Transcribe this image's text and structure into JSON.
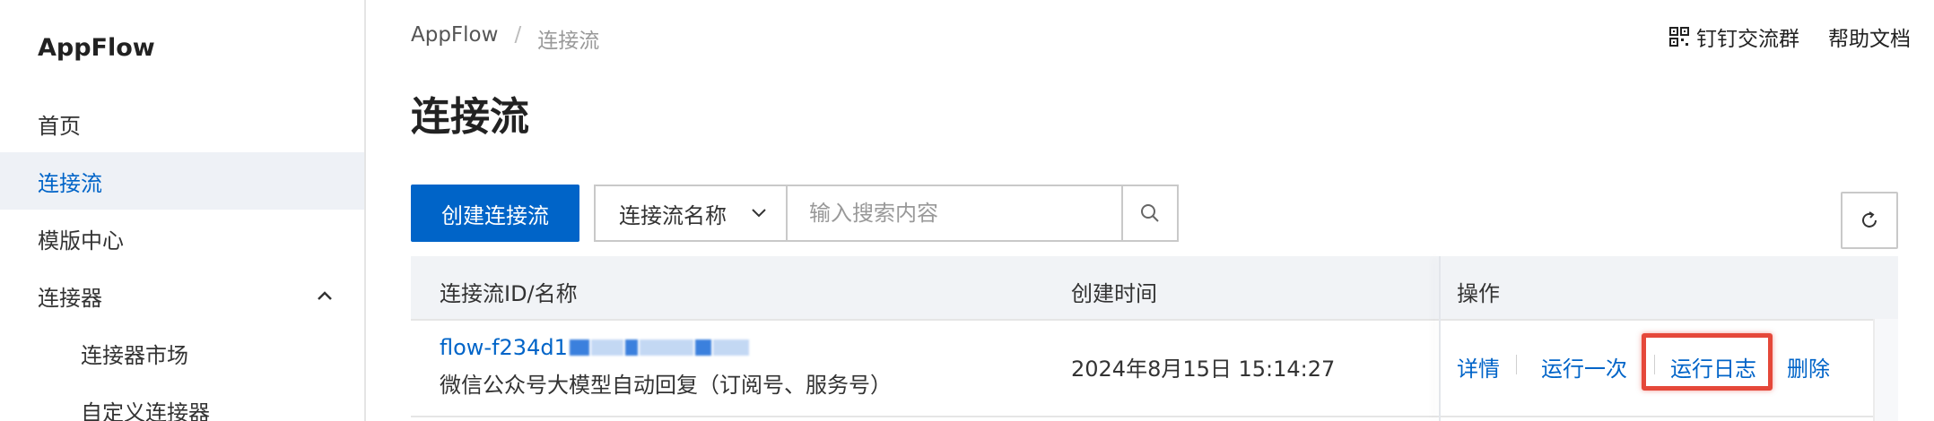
{
  "sidebar": {
    "brand": "AppFlow",
    "items": [
      {
        "label": "首页"
      },
      {
        "label": "连接流"
      },
      {
        "label": "模版中心"
      },
      {
        "label": "连接器"
      },
      {
        "label": "连接器市场"
      },
      {
        "label": "自定义连接器"
      }
    ]
  },
  "header": {
    "breadcrumb": [
      "AppFlow",
      "/",
      "连接流"
    ],
    "links": {
      "dingtalk": "钉钉交流群",
      "help": "帮助文档"
    },
    "title": "连接流"
  },
  "toolbar": {
    "create_label": "创建连接流",
    "filter_field": "连接流名称",
    "search_placeholder": "输入搜索内容"
  },
  "table": {
    "columns": [
      "连接流ID/名称",
      "创建时间",
      "操作"
    ],
    "rows": [
      {
        "id": "flow-f234d1",
        "name": "微信公众号大模型自动回复（订阅号、服务号）",
        "created": "2024年8月15日 15:14:27",
        "actions": [
          "详情",
          "运行一次",
          "运行日志",
          "删除"
        ]
      }
    ]
  },
  "colors": {
    "accent": "#0064c8",
    "highlight": "#e5483a",
    "sidebar_active_bg": "#eef1f6"
  }
}
